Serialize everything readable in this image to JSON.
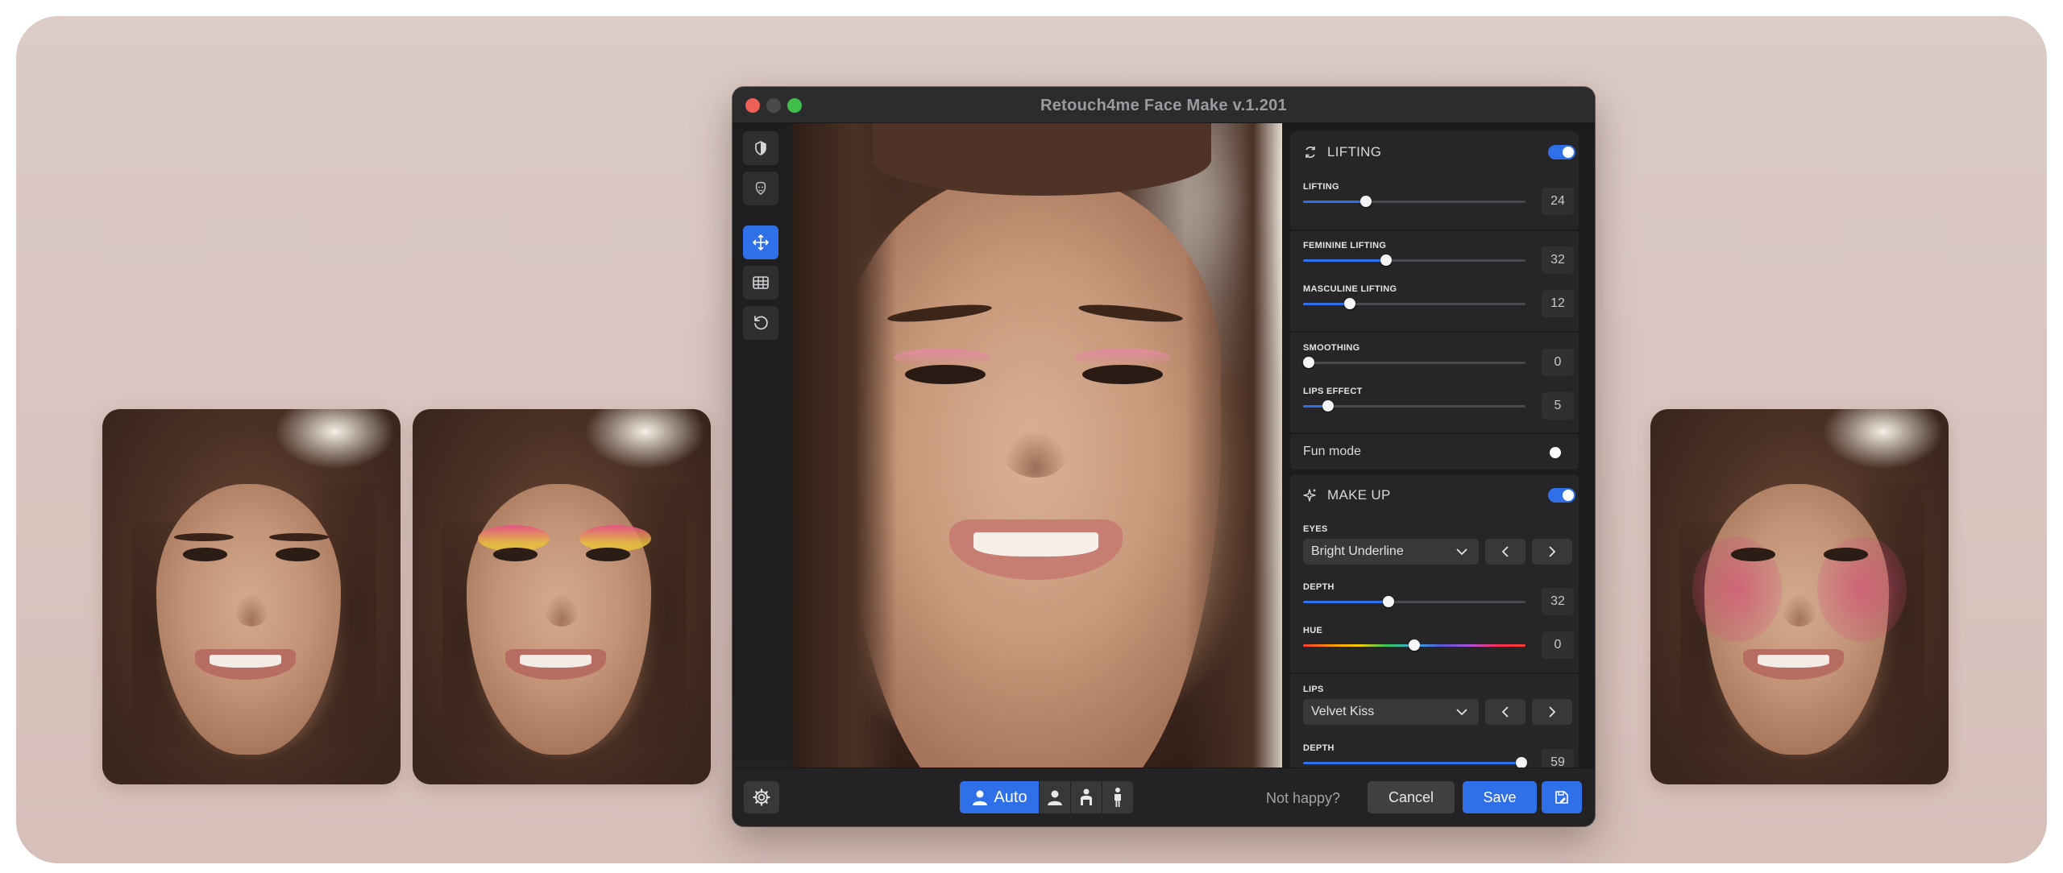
{
  "window": {
    "title": "Retouch4me  Face Make v.1.201",
    "traffic_colors": [
      "#ee5f57",
      "#4a4a4c",
      "#3fbf4a"
    ]
  },
  "left_toolbar": {
    "tools": [
      {
        "icon": "shield-half-icon",
        "active": false
      },
      {
        "icon": "face-mask-icon",
        "active": false
      },
      {
        "icon": "move-arrows-icon",
        "active": true
      },
      {
        "icon": "grid-icon",
        "active": false
      },
      {
        "icon": "reset-rotate-icon",
        "active": false
      }
    ]
  },
  "lifting": {
    "title": "LIFTING",
    "enabled": true,
    "sliders": {
      "lifting": {
        "label": "LIFTING",
        "value": "24"
      },
      "feminine": {
        "label": "FEMININE LIFTING",
        "value": "32"
      },
      "masculine": {
        "label": "MASCULINE LIFTING",
        "value": "12"
      },
      "smoothing": {
        "label": "SMOOTHING",
        "value": "0"
      },
      "lips_effect": {
        "label": "LIPS EFFECT",
        "value": "5"
      }
    },
    "fun_mode": {
      "label": "Fun mode",
      "enabled": false
    }
  },
  "makeup": {
    "title": "MAKE UP",
    "enabled": true,
    "eyes": {
      "label": "EYES",
      "preset": "Bright Underline",
      "depth": {
        "label": "DEPTH",
        "value": "32"
      },
      "hue": {
        "label": "HUE",
        "value": "0"
      }
    },
    "lips": {
      "label": "LIPS",
      "preset": "Velvet Kiss",
      "depth": {
        "label": "DEPTH",
        "value": "59"
      }
    }
  },
  "bottom_bar": {
    "mode_auto_label": "Auto",
    "not_happy": "Not happy?",
    "cancel": "Cancel",
    "save": "Save"
  },
  "colors": {
    "accent": "#2f6fe8",
    "window_bg": "#232325",
    "panel_bg": "#1c1c1e",
    "page_bg": "#dccbc6"
  }
}
